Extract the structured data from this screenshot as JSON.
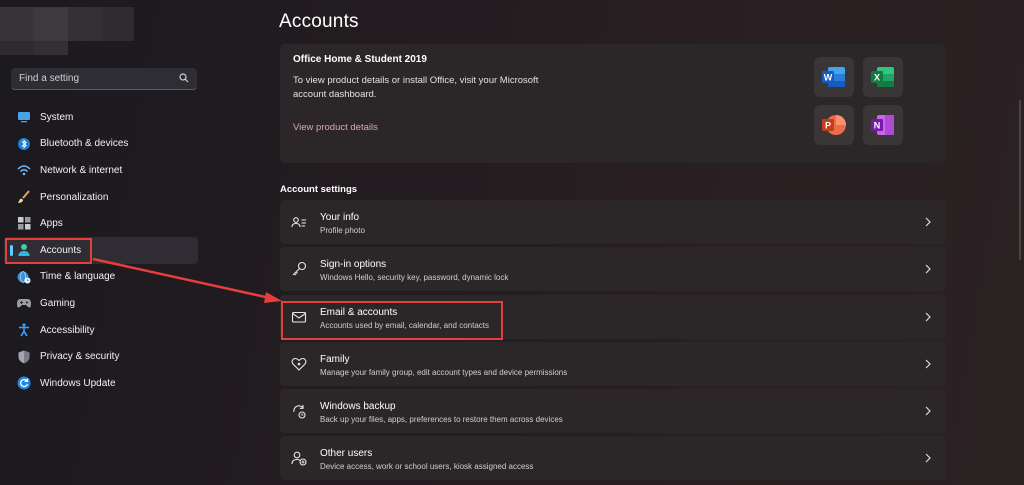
{
  "sidebar": {
    "search_placeholder": "Find a setting",
    "items": [
      {
        "label": "System",
        "icon": "display-icon"
      },
      {
        "label": "Bluetooth & devices",
        "icon": "bluetooth-icon"
      },
      {
        "label": "Network & internet",
        "icon": "wifi-icon"
      },
      {
        "label": "Personalization",
        "icon": "brush-icon"
      },
      {
        "label": "Apps",
        "icon": "apps-icon"
      },
      {
        "label": "Accounts",
        "icon": "person-icon",
        "selected": true
      },
      {
        "label": "Time & language",
        "icon": "globe-clock-icon"
      },
      {
        "label": "Gaming",
        "icon": "gamepad-icon"
      },
      {
        "label": "Accessibility",
        "icon": "accessibility-icon"
      },
      {
        "label": "Privacy & security",
        "icon": "shield-icon"
      },
      {
        "label": "Windows Update",
        "icon": "update-icon"
      }
    ]
  },
  "main": {
    "title": "Accounts",
    "office": {
      "title": "Office Home & Student 2019",
      "description": "To view product details or install Office, visit your Microsoft account dashboard.",
      "link": "View product details",
      "apps": [
        {
          "letter": "W",
          "name": "Word",
          "color": "#2b7cd3"
        },
        {
          "letter": "X",
          "name": "Excel",
          "color": "#21a366"
        },
        {
          "letter": "P",
          "name": "PowerPoint",
          "color": "#d35230"
        },
        {
          "letter": "N",
          "name": "OneNote",
          "color": "#7719aa"
        }
      ]
    },
    "section_title": "Account settings",
    "rows": [
      {
        "title": "Your info",
        "subtitle": "Profile photo",
        "icon": "contact-card-icon"
      },
      {
        "title": "Sign-in options",
        "subtitle": "Windows Hello, security key, password, dynamic lock",
        "icon": "key-icon"
      },
      {
        "title": "Email & accounts",
        "subtitle": "Accounts used by email, calendar, and contacts",
        "icon": "mail-icon"
      },
      {
        "title": "Family",
        "subtitle": "Manage your family group, edit account types and device permissions",
        "icon": "family-heart-icon"
      },
      {
        "title": "Windows backup",
        "subtitle": "Back up your files, apps, preferences to restore them across devices",
        "icon": "backup-icon"
      },
      {
        "title": "Other users",
        "subtitle": "Device access, work or school users, kiosk assigned access",
        "icon": "add-person-icon"
      }
    ]
  },
  "colors": {
    "accent": "#60cdff",
    "annotation": "#e63d3d",
    "card": "#2b2729"
  }
}
